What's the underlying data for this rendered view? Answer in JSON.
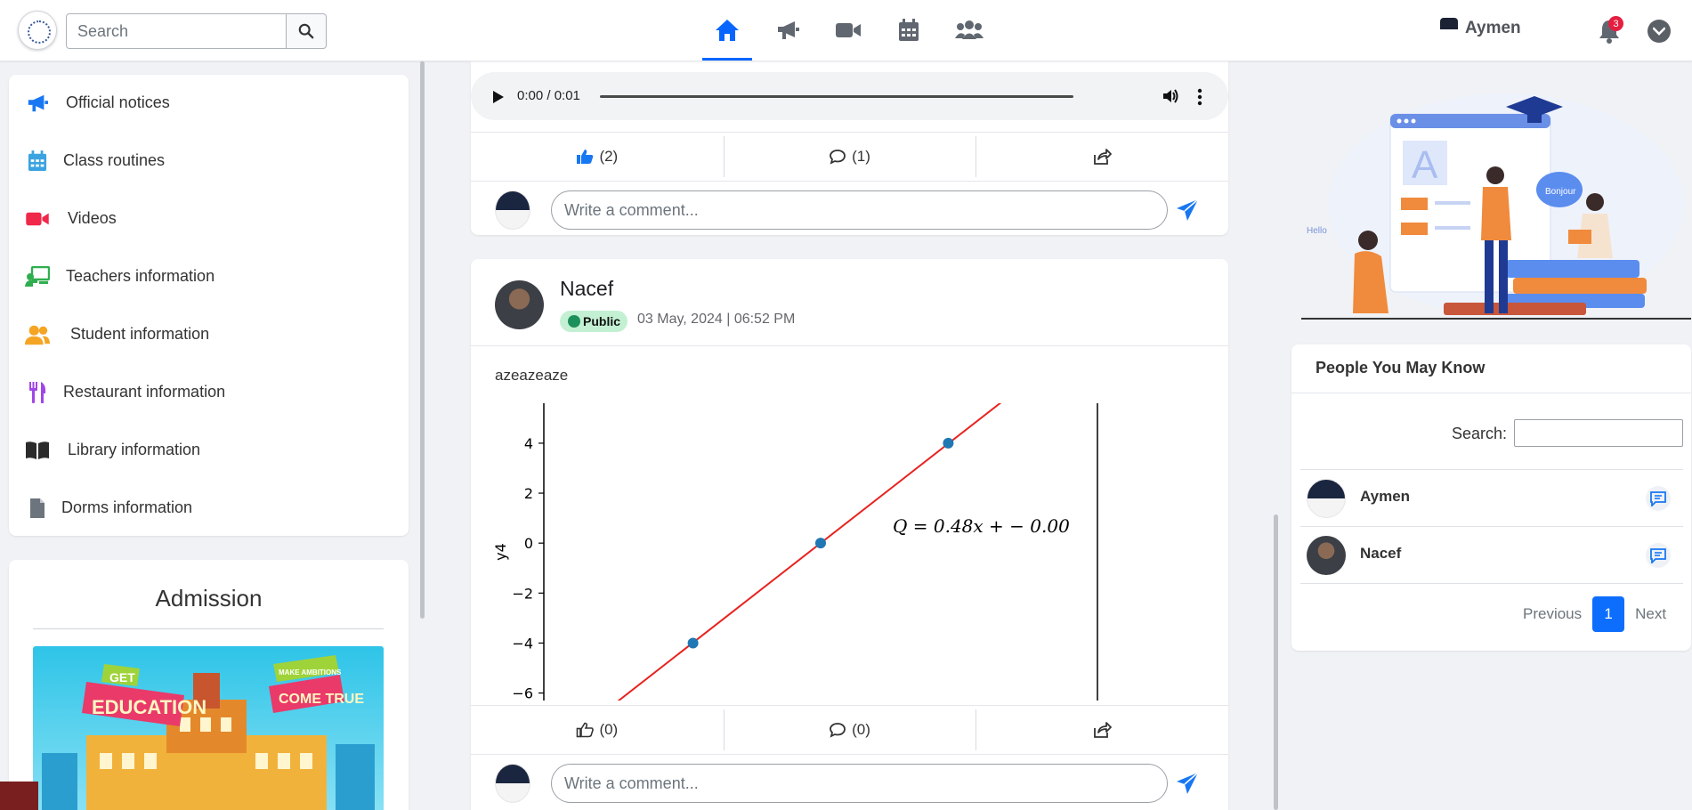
{
  "header": {
    "search_placeholder": "Search",
    "user_name": "Aymen",
    "notification_count": "3",
    "nav": [
      "home-icon",
      "megaphone-icon",
      "video-icon",
      "calendar-icon",
      "group-icon"
    ]
  },
  "sidebar": {
    "items": [
      {
        "label": "Official notices",
        "icon": "megaphone-icon",
        "color": "#1877f2"
      },
      {
        "label": "Class routines",
        "icon": "calendar-icon",
        "color": "#3ba3e0"
      },
      {
        "label": "Videos",
        "icon": "video-icon",
        "color": "#f0284a"
      },
      {
        "label": "Teachers information",
        "icon": "teacher-icon",
        "color": "#2fae4f"
      },
      {
        "label": "Student information",
        "icon": "users-icon",
        "color": "#f5a524"
      },
      {
        "label": "Restaurant information",
        "icon": "utensils-icon",
        "color": "#a146e6"
      },
      {
        "label": "Library information",
        "icon": "book-icon",
        "color": "#2b2b2b"
      },
      {
        "label": "Dorms information",
        "icon": "file-icon",
        "color": "#6c757d"
      }
    ]
  },
  "admission": {
    "title": "Admission",
    "banner_get": "GET",
    "banner_education": "EDUCATION",
    "banner_make": "MAKE AMBITIONS",
    "banner_come": "COME TRUE"
  },
  "post1": {
    "audio_time": "0:00 / 0:01",
    "likes": "(2)",
    "comments": "(1)",
    "comment_placeholder": "Write a comment..."
  },
  "post2": {
    "author": "Nacef",
    "visibility": "Public",
    "date": "03 May, 2024 | 06:52 PM",
    "text": "azeazeaze",
    "likes": "(0)",
    "comments": "(0)",
    "comment_placeholder": "Write a comment..."
  },
  "chart_data": {
    "type": "scatter",
    "ylabel": "y4",
    "xlabel": "",
    "title": "",
    "annotation": "Q = 0.48x +  − 0.00",
    "points": [
      {
        "x": -8.3,
        "y": -4
      },
      {
        "x": 0,
        "y": 0
      },
      {
        "x": 8.3,
        "y": 4
      }
    ],
    "fit_line": {
      "slope": 0.48,
      "intercept": 0
    },
    "xlim": [
      -18,
      18
    ],
    "ylim": [
      -6.3,
      5.6
    ],
    "y_ticks": [
      4,
      2,
      0,
      -2,
      -4,
      -6
    ],
    "y_tick_labels": [
      "4",
      "2",
      "0",
      "−2",
      "−4",
      "−6"
    ],
    "point_color": "#1f77b4",
    "line_color": "#e8231f"
  },
  "hero": {
    "bubble_text": "Bonjour",
    "hello_text": "Hello",
    "card_letter": "A"
  },
  "pymk": {
    "title": "People You May Know",
    "search_label": "Search:",
    "people": [
      {
        "name": "Aymen"
      },
      {
        "name": "Nacef"
      }
    ],
    "pager_prev": "Previous",
    "pager_current": "1",
    "pager_next": "Next"
  },
  "colors": {
    "primary": "#0866ff",
    "send": "#1877f2"
  }
}
